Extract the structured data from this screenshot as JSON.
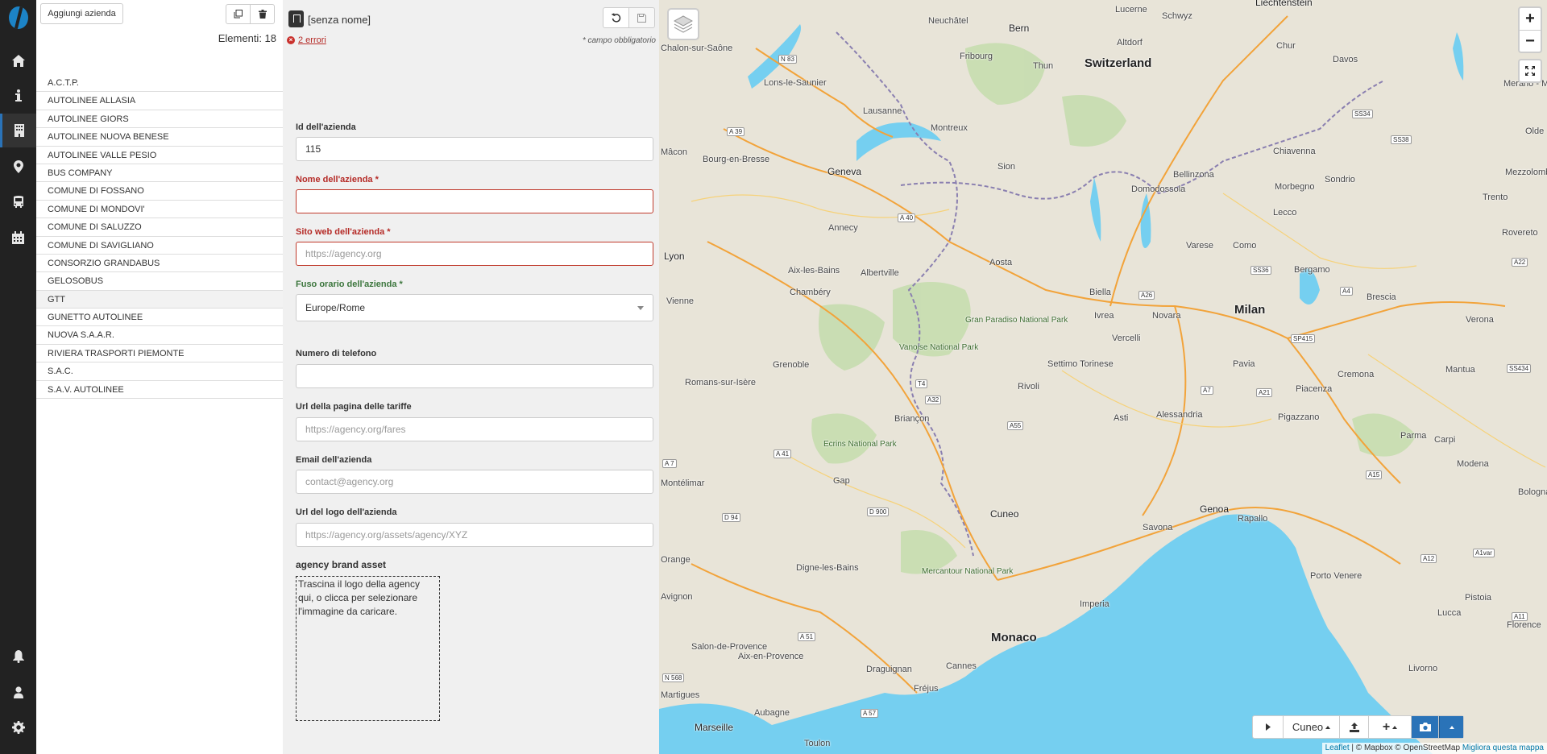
{
  "nav": {
    "items": [
      "home-icon",
      "info-icon",
      "building-icon",
      "map-marker-icon",
      "bus-icon",
      "calendar-icon"
    ],
    "bottom": [
      "bell-icon",
      "user-icon",
      "gear-icon"
    ],
    "active_color": "#2a73b8"
  },
  "list": {
    "add_button": "Aggiungi azienda",
    "count_label": "Elementi: 18",
    "agencies": [
      "A.C.T.P.",
      "AUTOLINEE ALLASIA",
      "AUTOLINEE GIORS",
      "AUTOLINEE NUOVA BENESE",
      "AUTOLINEE VALLE PESIO",
      "BUS COMPANY",
      "COMUNE DI FOSSANO",
      "COMUNE DI MONDOVI'",
      "COMUNE DI SALUZZO",
      "COMUNE DI SAVIGLIANO",
      "CONSORZIO GRANDABUS",
      "GELOSOBUS",
      "GTT",
      "GUNETTO AUTOLINEE",
      "NUOVA S.A.A.R.",
      "RIVIERA TRASPORTI PIEMONTE",
      "S.A.C.",
      "S.A.V. AUTOLINEE"
    ]
  },
  "form": {
    "title": "[senza nome]",
    "errors": "2 errori",
    "required_note": "* campo obbligatorio",
    "fields": {
      "id": {
        "label": "Id dell'azienda",
        "value": "115"
      },
      "name": {
        "label": "Nome dell'azienda *",
        "value": ""
      },
      "website": {
        "label": "Sito web dell'azienda *",
        "placeholder": "https://agency.org"
      },
      "timezone": {
        "label": "Fuso orario dell'azienda *",
        "value": "Europe/Rome"
      },
      "phone": {
        "label": "Numero di telefono",
        "value": ""
      },
      "fares": {
        "label": "Url della pagina delle tariffe",
        "placeholder": "https://agency.org/fares"
      },
      "email": {
        "label": "Email dell'azienda",
        "placeholder": "contact@agency.org"
      },
      "logo": {
        "label": "Url del logo dell'azienda",
        "placeholder": "https://agency.org/assets/agency/XYZ"
      }
    },
    "asset_title": "agency brand asset",
    "dropzone_text": "Trascina il logo della agency qui, o clicca per selezionare l'immagine da caricare."
  },
  "map": {
    "labels": {
      "switzerland": "Switzerland",
      "milan": "Milan",
      "monaco": "Monaco",
      "marseille": "Marseille",
      "bern": "Bern",
      "lucerne": "Lucerne",
      "schwyz": "Schwyz",
      "neuchatel": "Neuchâtel",
      "fribourg": "Fribourg",
      "thun": "Thun",
      "lausanne": "Lausanne",
      "montreux": "Montreux",
      "geneva": "Geneva",
      "sion": "Sion",
      "annecy": "Annecy",
      "chambery": "Chambéry",
      "grenoble": "Grenoble",
      "lyon": "Lyon",
      "vienne": "Vienne",
      "aosta": "Aosta",
      "biella": "Biella",
      "novara": "Novara",
      "vercelli": "Vercelli",
      "settimo": "Settimo Torinese",
      "rivoli": "Rivoli",
      "asti": "Asti",
      "alessandria": "Alessandria",
      "pavia": "Pavia",
      "piacenza": "Piacenza",
      "cremona": "Cremona",
      "parma": "Parma",
      "bergamo": "Bergamo",
      "brescia": "Brescia",
      "como": "Como",
      "varese": "Varese",
      "lugano": "Bellinzona",
      "sondrio": "Sondrio",
      "chur": "Chur",
      "davos": "Davos",
      "trento": "Trento",
      "verona": "Verona",
      "genoa": "Genoa",
      "savona": "Savona",
      "rapallo": "Rapallo",
      "cuneo": "Cuneo",
      "gap": "Gap",
      "briancon": "Briançon",
      "digne": "Digne-les-Bains",
      "aix": "Aix-en-Provence",
      "cannes": "Cannes",
      "imperia": "Imperia",
      "toulon": "Toulon",
      "aubagne": "Aubagne",
      "draguignan": "Draguignan",
      "frejus": "Fréjus",
      "valence": "Romans-sur-Isère",
      "macon": "Mâcon",
      "bourg": "Bourg-en-Bresse",
      "lons": "Lons-le-Saunier",
      "chalon": "Chalon-sur-Saône",
      "aixbains": "Aix-les-Bains",
      "albertville": "Albertville",
      "domodossola": "Domodossola",
      "chiavenna": "Chiavenna",
      "morbegno": "Morbegno",
      "pigazzano": "Pigazzano",
      "modena": "Modena",
      "carpi": "Carpi",
      "mantua": "Mantua",
      "bologna": "Bologna",
      "pistoia": "Pistoia",
      "florence": "Florence",
      "lucca": "Lucca",
      "livorno": "Livorno",
      "portovenere": "Porto Venere",
      "ivrea": "Ivrea",
      "salon": "Salon-de-Provence",
      "martigues": "Martigues",
      "orange": "Orange",
      "avignon": "Avignon",
      "montelimar": "Montélimar",
      "mezzolombardo": "Mezzolombardo",
      "merano": "Merano - Meran",
      "rovereto": "Rovereto",
      "olde": "Olde",
      "sedrun": "Altdorf",
      "liechtenstein": "Liechtenstein",
      "paradiso": "Gran Paradiso National Park",
      "vanoise": "Vanoise National Park",
      "ecrins": "Ecrins National Park",
      "mercantour": "Mercantour National Park",
      "lecco": "Lecco"
    },
    "roads": [
      "A 39",
      "N 83",
      "A 40",
      "A 41",
      "A 7",
      "A 51",
      "D 94",
      "D 900",
      "A 57",
      "N 568",
      "T4",
      "A32",
      "A55",
      "A26",
      "A4",
      "A7",
      "A21",
      "A15",
      "A12",
      "A1var",
      "A11",
      "A22",
      "SS36",
      "SP415",
      "SS38",
      "SS34",
      "SS434"
    ],
    "layers_icon": "layers-icon",
    "zoom_in": "+",
    "zoom_out": "−",
    "toolbar": {
      "region": "Cuneo"
    },
    "attribution_leaflet": "Leaflet",
    "attribution_rest": "| © Mapbox © OpenStreetMap",
    "attribution_improve": "Migliora questa mappa",
    "colors": {
      "water": "#75cff0",
      "land": "#e8e4d8",
      "parks": "#b8d8a0",
      "roads": "#f2a33a"
    }
  }
}
